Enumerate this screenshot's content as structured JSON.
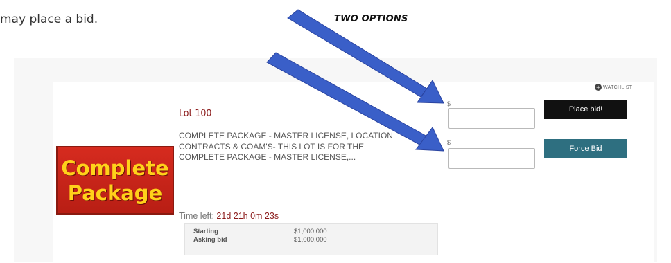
{
  "intro_text": "may place a bid.",
  "callout_text": "TWO OPTIONS",
  "thumbnail": {
    "line1": "Complete",
    "line2": "Package"
  },
  "lot": {
    "title": "Lot 100",
    "description": "COMPLETE PACKAGE - MASTER LICENSE, LOCATION CONTRACTS & COAM'S- THIS LOT IS FOR THE COMPLETE PACKAGE - MASTER LICENSE,...",
    "time_left_label": "Time left:",
    "time_left_value": "21d 21h 0m 23s",
    "stats": [
      {
        "label": "Starting",
        "value": "$1,000,000"
      },
      {
        "label": "Asking bid",
        "value": "$1,000,000"
      }
    ]
  },
  "bid_form": {
    "currency": "$",
    "place_bid_label": "Place bid!",
    "force_bid_label": "Force Bid"
  },
  "watchlist_label": "WATCHLIST",
  "colors": {
    "arrow": "#3a5fc8",
    "place_bid": "#111111",
    "force_bid": "#2e6f80",
    "lot_title": "#8b1a1a"
  }
}
